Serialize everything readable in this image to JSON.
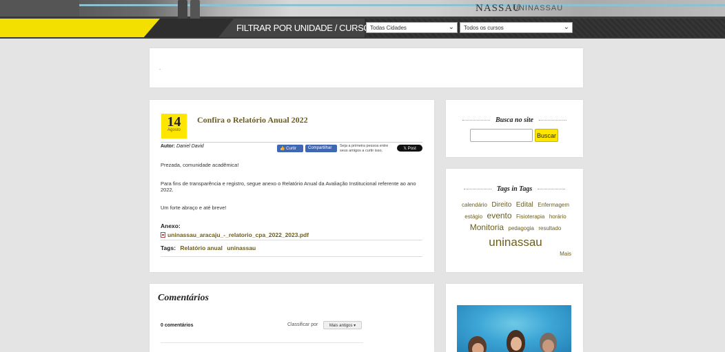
{
  "header": {
    "brand_partial": "NASSAU",
    "brand_suffix_partial": "UNINASSAU",
    "filter_label": "FILTRAR POR UNIDADE / CURSO:",
    "city_select": {
      "value": "Todas Cidades"
    },
    "course_select": {
      "value": "Todos os cursos"
    },
    "colors": {
      "accent_yellow": "#f4e000",
      "bar_dark": "#2e2e2e"
    }
  },
  "top_card": {
    "text": "-"
  },
  "post": {
    "date_day": "14",
    "date_month": "Agosto",
    "title": "Confira o Relatório Anual 2022",
    "author_label": "Autor:",
    "author_name": "Daniel David",
    "social": {
      "like_label": "Curtir",
      "share_label": "Compartilhar",
      "first_text": "Seja a primeira pessoa entre seus amigos a curtir isso.",
      "x_post_label": "Post"
    },
    "paragraphs": [
      "Prezada, comunidade acadêmica!",
      "Para fins de transparência e registro, segue anexo o Relatório Anual da Avaliação Institucional referente ao ano 2022.",
      "Um forte abraço e até breve!"
    ],
    "attachment_label": "Anexo:",
    "attachment_file": "uninassau_aracaju_-_relatorio_cpa_2022_2023.pdf",
    "tags_label": "Tags:",
    "tags": [
      "Relatório anual",
      "uninassau"
    ]
  },
  "search_widget": {
    "title": "Busca no site",
    "input_value": "",
    "button_label": "Buscar"
  },
  "tags_widget": {
    "title": "Tags in Tags",
    "tags": [
      {
        "label": "calendário",
        "weight": 1
      },
      {
        "label": "Direito",
        "weight": 2
      },
      {
        "label": "Edital",
        "weight": 2
      },
      {
        "label": "Enfermagem",
        "weight": 1
      },
      {
        "label": "estágio",
        "weight": 1
      },
      {
        "label": "evento",
        "weight": 3
      },
      {
        "label": "Fisioterapia",
        "weight": 1
      },
      {
        "label": "horário",
        "weight": 1
      },
      {
        "label": "Monitoria",
        "weight": 3
      },
      {
        "label": "pedagogia",
        "weight": 1
      },
      {
        "label": "resultado",
        "weight": 1
      },
      {
        "label": "uninassau",
        "weight": 5
      }
    ],
    "more_label": "Mais"
  },
  "comments": {
    "title": "Comentários",
    "count_text": "0 comentários",
    "sort_label": "Classificar por",
    "sort_value": "Mais antigos"
  }
}
